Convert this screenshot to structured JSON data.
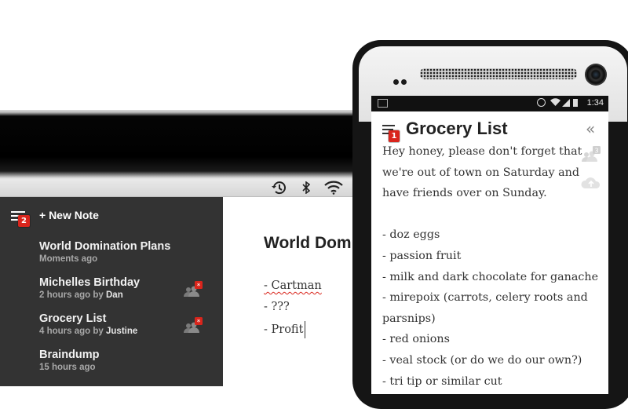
{
  "tablet": {
    "status_icons": [
      "history-icon",
      "bluetooth-icon",
      "wifi-icon"
    ],
    "sidebar": {
      "badge": "2",
      "new_note_label": "+ New Note",
      "notes": [
        {
          "title": "World Domination Plans",
          "time": "Moments ago",
          "by": "",
          "user": ""
        },
        {
          "title": "Michelles Birthday",
          "time": "2 hours ago",
          "by": " by ",
          "user": "Dan"
        },
        {
          "title": "Grocery List",
          "time": "4 hours ago",
          "by": " by ",
          "user": "Justine"
        },
        {
          "title": "Braindump",
          "time": "15 hours ago",
          "by": "",
          "user": ""
        }
      ]
    },
    "editor": {
      "title": "World Domination Plans",
      "lines": [
        "- Cartman",
        "- ???",
        "- Profit"
      ]
    }
  },
  "phone": {
    "status": {
      "clock": "1:34"
    },
    "badge": "1",
    "title": "Grocery List",
    "share_count": "3",
    "lines": [
      "Hey honey, please don't forget that",
      "we're out of town on Saturday and",
      "have friends over on Sunday.",
      "",
      "- doz eggs",
      "- passion fruit",
      "- milk and dark chocolate for ganache",
      "- mirepoix (carrots, celery roots and",
      "parsnips)",
      "- red onions",
      "- veal stock (or do we do our own?)",
      "- tri tip or similar cut"
    ]
  },
  "colors": {
    "sidebar_bg": "#333333",
    "badge_red": "#d9251c",
    "accent_dark": "#222222"
  }
}
